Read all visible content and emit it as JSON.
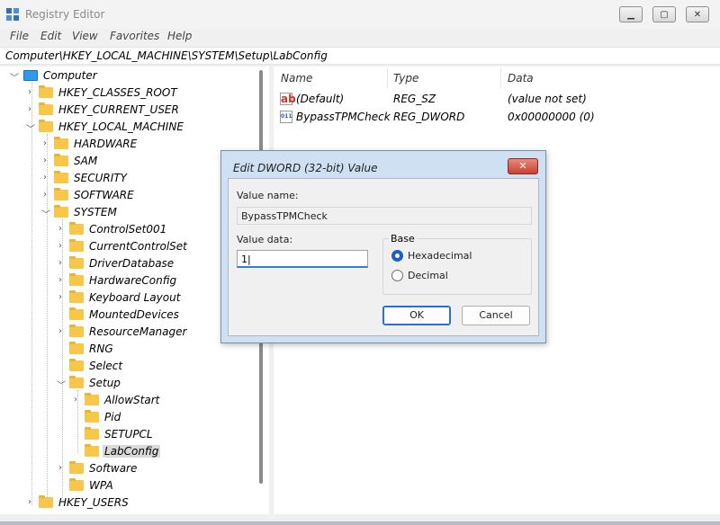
{
  "window": {
    "title": "Registry Editor"
  },
  "menu": [
    "File",
    "Edit",
    "View",
    "Favorites",
    "Help"
  ],
  "address": "Computer\\HKEY_LOCAL_MACHINE\\SYSTEM\\Setup\\LabConfig",
  "tree": {
    "computer": "Computer",
    "hkcr": "HKEY_CLASSES_ROOT",
    "hkcu": "HKEY_CURRENT_USER",
    "hklm": "HKEY_LOCAL_MACHINE",
    "hardware": "HARDWARE",
    "sam": "SAM",
    "security": "SECURITY",
    "software": "SOFTWARE",
    "system": "SYSTEM",
    "controlset001": "ControlSet001",
    "currentcontrolset": "CurrentControlSet",
    "driverdatabase": "DriverDatabase",
    "hardwareconfig": "HardwareConfig",
    "keyboardlayout": "Keyboard Layout",
    "mounteddevices": "MountedDevices",
    "resourcemanager": "ResourceManager",
    "rng": "RNG",
    "select": "Select",
    "setup": "Setup",
    "allowstart": "AllowStart",
    "pid": "Pid",
    "setupcl": "SETUPCL",
    "labconfig": "LabConfig",
    "software2": "Software",
    "wpa": "WPA",
    "hku": "HKEY_USERS"
  },
  "list": {
    "headers": {
      "name": "Name",
      "type": "Type",
      "data": "Data"
    },
    "rows": [
      {
        "name": "(Default)",
        "type": "REG_SZ",
        "data": "(value not set)",
        "icon": "ab"
      },
      {
        "name": "BypassTPMCheck",
        "type": "REG_DWORD",
        "data": "0x00000000 (0)",
        "icon": "011"
      }
    ]
  },
  "dialog": {
    "title": "Edit DWORD (32-bit) Value",
    "value_name_label": "Value name:",
    "value_name": "BypassTPMCheck",
    "value_data_label": "Value data:",
    "value_data": "1",
    "base_label": "Base",
    "hex_label": "Hexadecimal",
    "dec_label": "Decimal",
    "ok_label": "OK",
    "cancel_label": "Cancel",
    "selected_base": "Hexadecimal"
  }
}
